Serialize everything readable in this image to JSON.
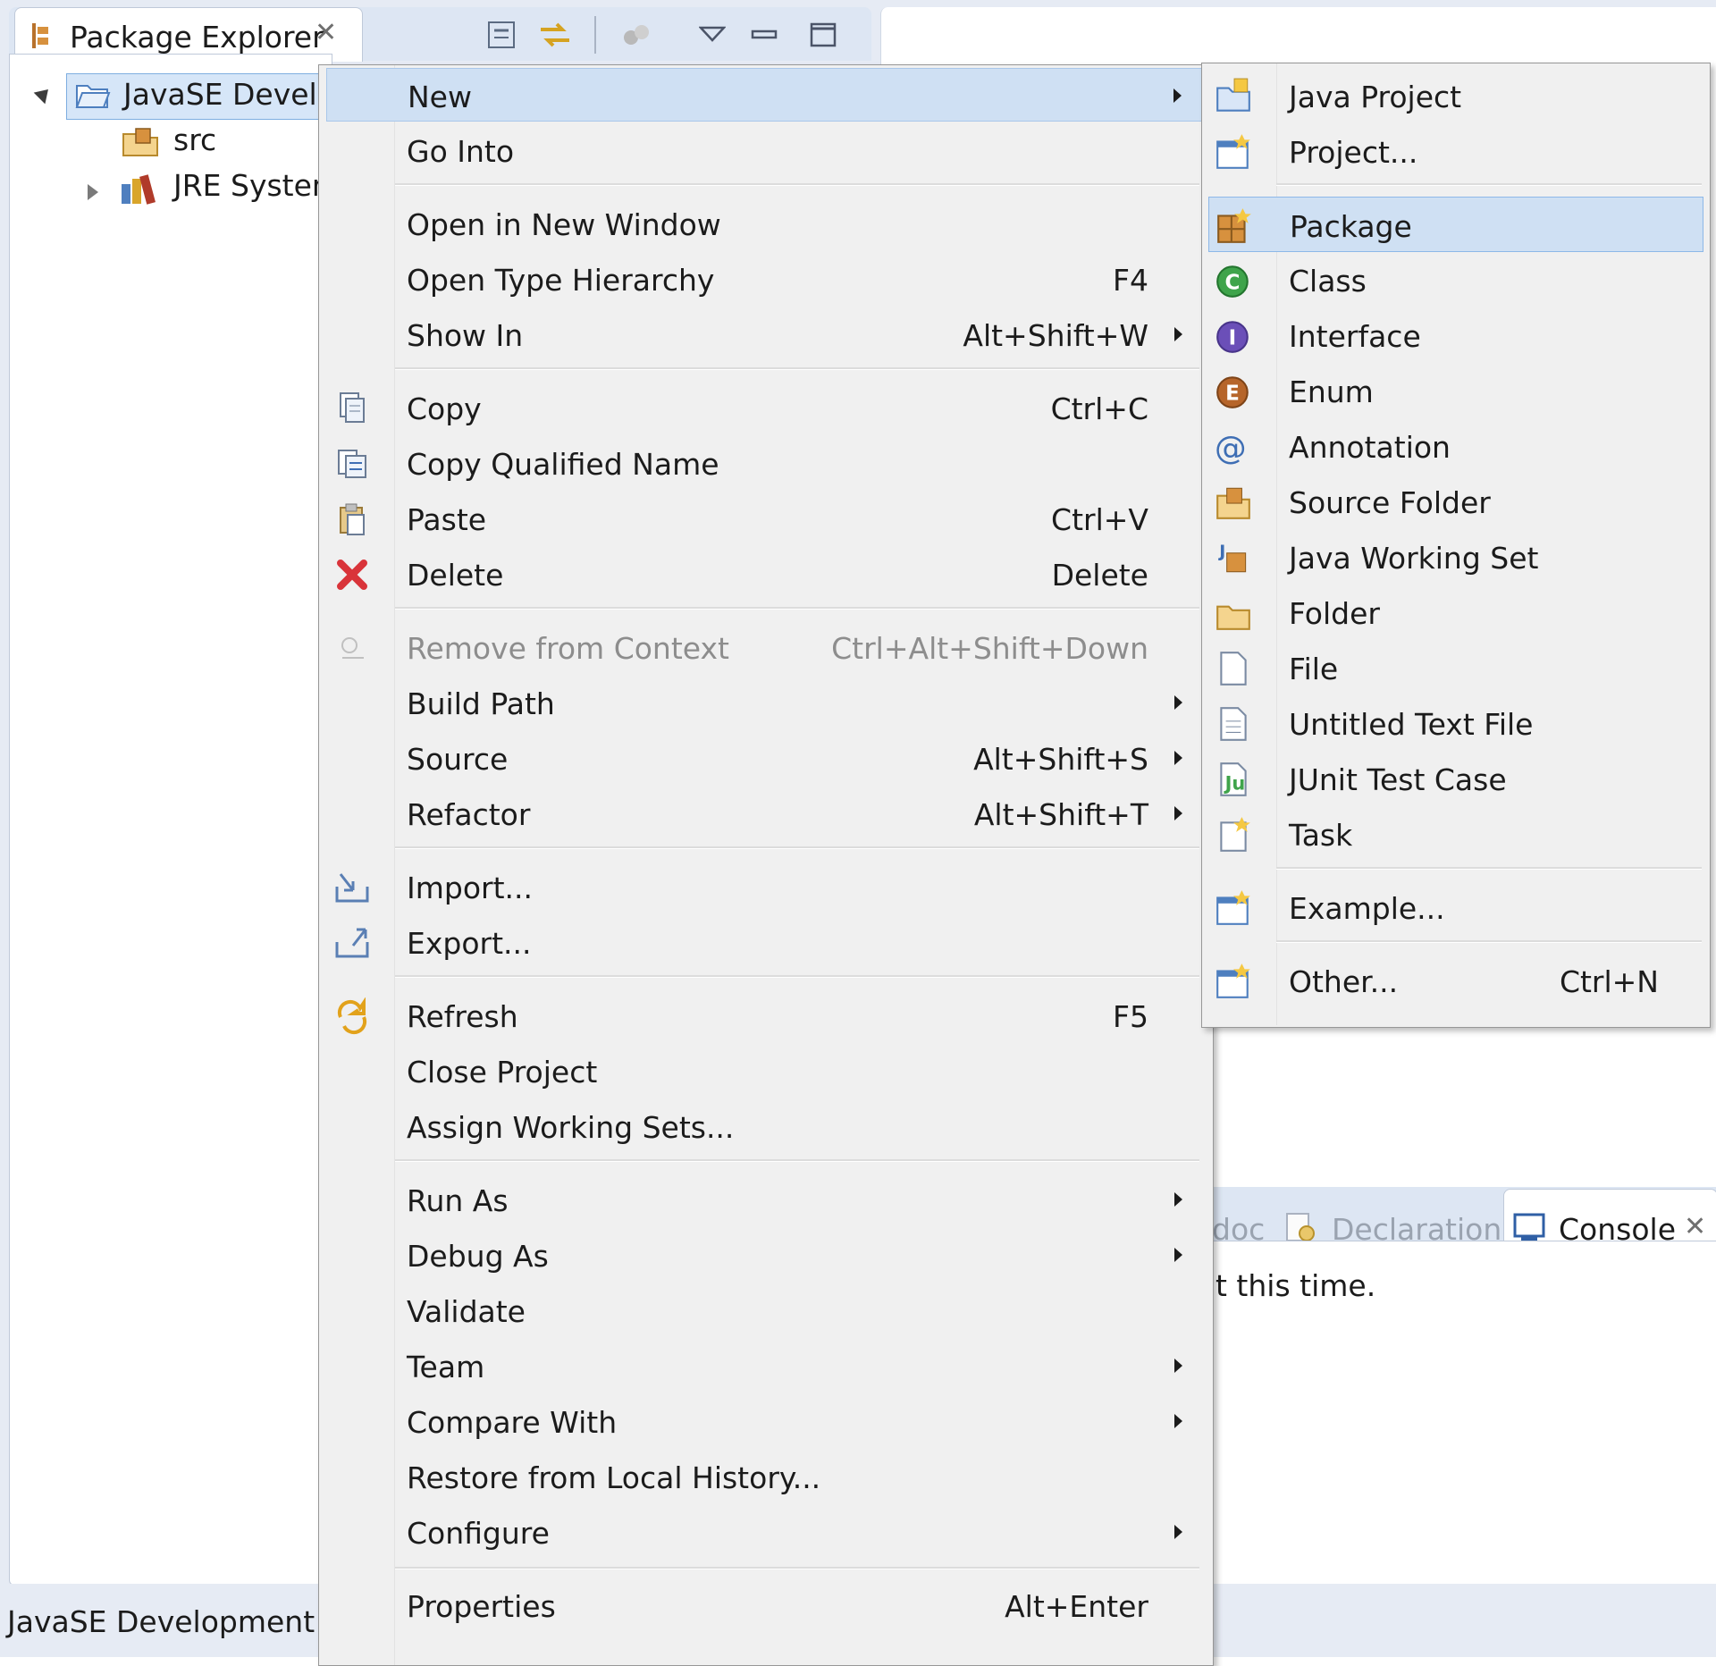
{
  "explorer": {
    "tab_label": "Package Explorer",
    "tree": {
      "project": "JavaSE Develop",
      "src": "src",
      "jre": "JRE System"
    }
  },
  "context_menu": {
    "items": [
      {
        "label": "New",
        "shortcut": "",
        "submenu": true,
        "highlight": true,
        "icon": ""
      },
      {
        "label": "Go Into",
        "shortcut": "",
        "submenu": false,
        "icon": ""
      },
      {
        "label": "Open in New Window",
        "shortcut": "",
        "submenu": false,
        "icon": ""
      },
      {
        "label": "Open Type Hierarchy",
        "shortcut": "F4",
        "submenu": false,
        "icon": ""
      },
      {
        "label": "Show In",
        "shortcut": "Alt+Shift+W",
        "submenu": true,
        "icon": ""
      },
      {
        "label": "Copy",
        "shortcut": "Ctrl+C",
        "submenu": false,
        "icon": "copy-icon"
      },
      {
        "label": "Copy Qualified Name",
        "shortcut": "",
        "submenu": false,
        "icon": "copy-qualified-name-icon"
      },
      {
        "label": "Paste",
        "shortcut": "Ctrl+V",
        "submenu": false,
        "icon": "paste-icon"
      },
      {
        "label": "Delete",
        "shortcut": "Delete",
        "submenu": false,
        "icon": "delete-icon"
      },
      {
        "label": "Remove from Context",
        "shortcut": "Ctrl+Alt+Shift+Down",
        "submenu": false,
        "disabled": true,
        "icon": "remove-context-icon"
      },
      {
        "label": "Build Path",
        "shortcut": "",
        "submenu": true,
        "icon": ""
      },
      {
        "label": "Source",
        "shortcut": "Alt+Shift+S",
        "submenu": true,
        "icon": ""
      },
      {
        "label": "Refactor",
        "shortcut": "Alt+Shift+T",
        "submenu": true,
        "icon": ""
      },
      {
        "label": "Import...",
        "shortcut": "",
        "submenu": false,
        "icon": "import-icon"
      },
      {
        "label": "Export...",
        "shortcut": "",
        "submenu": false,
        "icon": "export-icon"
      },
      {
        "label": "Refresh",
        "shortcut": "F5",
        "submenu": false,
        "icon": "refresh-icon"
      },
      {
        "label": "Close Project",
        "shortcut": "",
        "submenu": false,
        "icon": ""
      },
      {
        "label": "Assign Working Sets...",
        "shortcut": "",
        "submenu": false,
        "icon": ""
      },
      {
        "label": "Run As",
        "shortcut": "",
        "submenu": true,
        "icon": ""
      },
      {
        "label": "Debug As",
        "shortcut": "",
        "submenu": true,
        "icon": ""
      },
      {
        "label": "Validate",
        "shortcut": "",
        "submenu": false,
        "icon": ""
      },
      {
        "label": "Team",
        "shortcut": "",
        "submenu": true,
        "icon": ""
      },
      {
        "label": "Compare With",
        "shortcut": "",
        "submenu": true,
        "icon": ""
      },
      {
        "label": "Restore from Local History...",
        "shortcut": "",
        "submenu": false,
        "icon": ""
      },
      {
        "label": "Configure",
        "shortcut": "",
        "submenu": true,
        "icon": ""
      },
      {
        "label": "Properties",
        "shortcut": "Alt+Enter",
        "submenu": false,
        "icon": ""
      }
    ]
  },
  "new_submenu": {
    "items": [
      {
        "label": "Java Project",
        "shortcut": "",
        "icon": "java-project-icon"
      },
      {
        "label": "Project...",
        "shortcut": "",
        "icon": "project-icon"
      },
      {
        "label": "Package",
        "shortcut": "",
        "icon": "package-icon",
        "highlight": true
      },
      {
        "label": "Class",
        "shortcut": "",
        "icon": "class-icon"
      },
      {
        "label": "Interface",
        "shortcut": "",
        "icon": "interface-icon"
      },
      {
        "label": "Enum",
        "shortcut": "",
        "icon": "enum-icon"
      },
      {
        "label": "Annotation",
        "shortcut": "",
        "icon": "annotation-icon"
      },
      {
        "label": "Source Folder",
        "shortcut": "",
        "icon": "source-folder-icon"
      },
      {
        "label": "Java Working Set",
        "shortcut": "",
        "icon": "working-set-icon"
      },
      {
        "label": "Folder",
        "shortcut": "",
        "icon": "folder-icon"
      },
      {
        "label": "File",
        "shortcut": "",
        "icon": "file-icon"
      },
      {
        "label": "Untitled Text File",
        "shortcut": "",
        "icon": "text-file-icon"
      },
      {
        "label": "JUnit Test Case",
        "shortcut": "",
        "icon": "junit-icon"
      },
      {
        "label": "Task",
        "shortcut": "",
        "icon": "task-icon"
      },
      {
        "label": "Example...",
        "shortcut": "",
        "icon": "example-icon"
      },
      {
        "label": "Other...",
        "shortcut": "Ctrl+N",
        "icon": "other-icon"
      }
    ]
  },
  "bottom_panel": {
    "tab_doc": "doc",
    "tab_declaration": "Declaration",
    "tab_console": "Console",
    "message": "t this time."
  },
  "status_bar": {
    "text": "JavaSE Development"
  },
  "colors": {
    "highlight": "#cfe0f3",
    "menu_bg": "#f0f0f0",
    "disabled": "#8d8d8d"
  }
}
